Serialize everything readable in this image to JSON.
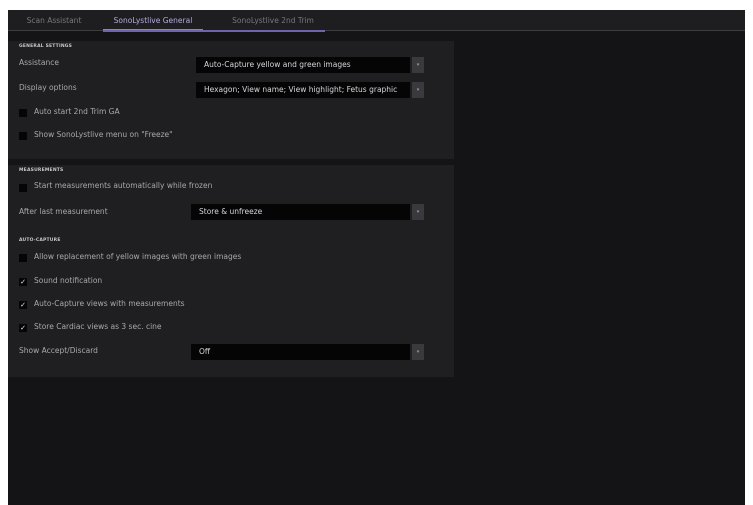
{
  "tabs": [
    {
      "label": "Scan Assistant",
      "active": false
    },
    {
      "label": "SonoLystlive General",
      "active": true
    },
    {
      "label": "SonoLystlive 2nd Trim",
      "active": false
    }
  ],
  "general": {
    "title": "GENERAL SETTINGS",
    "assistance_label": "Assistance",
    "assistance_value": "Auto-Capture yellow and green images",
    "display_label": "Display options",
    "display_value": "Hexagon; View name; View highlight; Fetus graphic",
    "auto_start_label": "Auto start 2nd Trim GA",
    "auto_start_checked": false,
    "show_menu_label": "Show SonoLystlive menu on \"Freeze\"",
    "show_menu_checked": false
  },
  "measurements": {
    "title": "MEASUREMENTS",
    "start_label": "Start measurements automatically while frozen",
    "start_checked": false,
    "after_label": "After last measurement",
    "after_value": "Store & unfreeze"
  },
  "autocapture": {
    "title": "AUTO-CAPTURE",
    "allow_label": "Allow replacement of yellow images with green images",
    "allow_checked": false,
    "sound_label": "Sound notification",
    "sound_checked": true,
    "views_label": "Auto-Capture views with measurements",
    "views_checked": true,
    "cardiac_label": "Store Cardiac views as 3 sec. cine",
    "cardiac_checked": true,
    "accept_label": "Show Accept/Discard",
    "accept_value": "Off"
  },
  "icons": {
    "dropdown": "chevron-down-icon",
    "checkmark": "check-icon"
  },
  "colors": {
    "accent": "#8e7fd0",
    "panel": "#1f1f21",
    "background": "#141416"
  }
}
